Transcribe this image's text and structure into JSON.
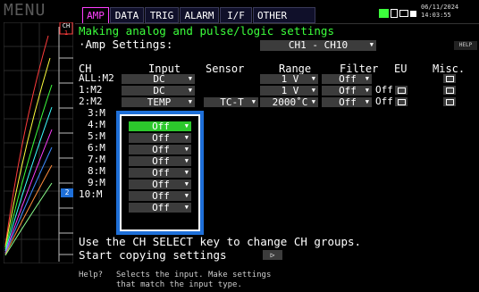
{
  "app": {
    "menu_title": "MENU"
  },
  "preview": {
    "ch_label": "CH",
    "ch_badge": "1",
    "cursor_badge": "2"
  },
  "tabs": [
    {
      "label": "AMP",
      "active": true
    },
    {
      "label": "DATA",
      "active": false
    },
    {
      "label": "TRIG",
      "active": false
    },
    {
      "label": "ALARM",
      "active": false
    },
    {
      "label": "I/F",
      "active": false
    },
    {
      "label": "OTHER",
      "active": false
    }
  ],
  "status": {
    "date": "06/11/2024",
    "time": "14:03:55",
    "icons": [
      "battery-icon",
      "card-icon",
      "memory-icon",
      "lock-icon"
    ]
  },
  "main": {
    "title": "Making analog and pulse/logic settings",
    "amp_label": "·Amp Settings:",
    "ch_group": "CH1 - CH10",
    "help_button": "HELP",
    "headers": {
      "ch": "CH",
      "input": "Input",
      "sensor": "Sensor",
      "range": "Range",
      "filter": "Filter",
      "eu": "EU",
      "misc": "Misc."
    },
    "rows": [
      {
        "ch": "ALL:M2",
        "input": "DC",
        "range": "1 V",
        "filter": "Off"
      },
      {
        "ch": "1:M2",
        "input": "DC",
        "range": "1 V",
        "filter": "Off",
        "eu": "Off"
      },
      {
        "ch": "2:M2",
        "input": "TEMP",
        "sensor": "TC-T",
        "range": "2000˚C",
        "filter": "Off",
        "eu": "Off"
      },
      {
        "ch": "3:M"
      },
      {
        "ch": "4:M"
      },
      {
        "ch": "5:M"
      },
      {
        "ch": "6:M"
      },
      {
        "ch": "7:M"
      },
      {
        "ch": "8:M"
      },
      {
        "ch": "9:M"
      },
      {
        "ch": "10:M"
      }
    ],
    "popup_options": [
      "Off",
      "Off",
      "Off",
      "Off",
      "Off",
      "Off",
      "Off",
      "Off"
    ],
    "footer_line": "Use the CH SELECT key to change CH groups.",
    "copy_label": "Start copying settings",
    "copy_button": "▷"
  },
  "help": {
    "label": "Help?",
    "line1": "Selects the input. Make settings",
    "line2": "that match the input type."
  },
  "colors": {
    "title": "#3cff3c",
    "tab_active": "#ff40ff",
    "selected": "#2cc82c",
    "popup_border": "#1e6fd8"
  }
}
